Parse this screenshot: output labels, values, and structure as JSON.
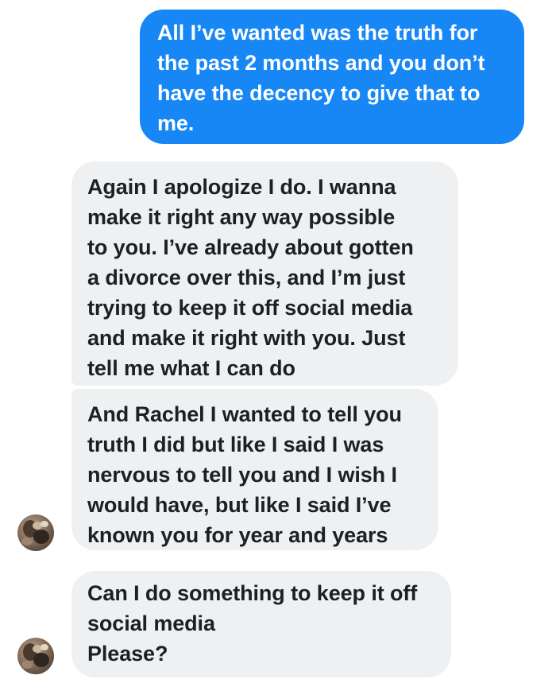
{
  "conversation": {
    "messages": [
      {
        "sender": "me",
        "text": "All I’ve wanted was the truth for\nthe past 2 months and you don’t\nhave the decency to give that to\nme."
      },
      {
        "sender": "other",
        "text": "Again I apologize I do. I wanna\nmake it right any way possible\nto you. I’ve already about gotten\na divorce over this, and I’m just\ntrying to keep it off social media\nand make it right with you. Just\ntell me what I can do"
      },
      {
        "sender": "other",
        "text": "And Rachel I wanted to tell you\ntruth I did but like I said I was\nnervous to tell you and I wish I\nwould have, but like I said I’ve\nknown you for year and years"
      },
      {
        "sender": "other",
        "text": "Can I do something to keep it off\nsocial media\nPlease?"
      }
    ]
  },
  "colors": {
    "outgoing_bubble": "#1887f6",
    "incoming_bubble": "#eff0f2",
    "outgoing_text": "#ffffff",
    "incoming_text": "#1e1f22"
  },
  "icons": {
    "avatar": "contact-avatar-photo"
  }
}
